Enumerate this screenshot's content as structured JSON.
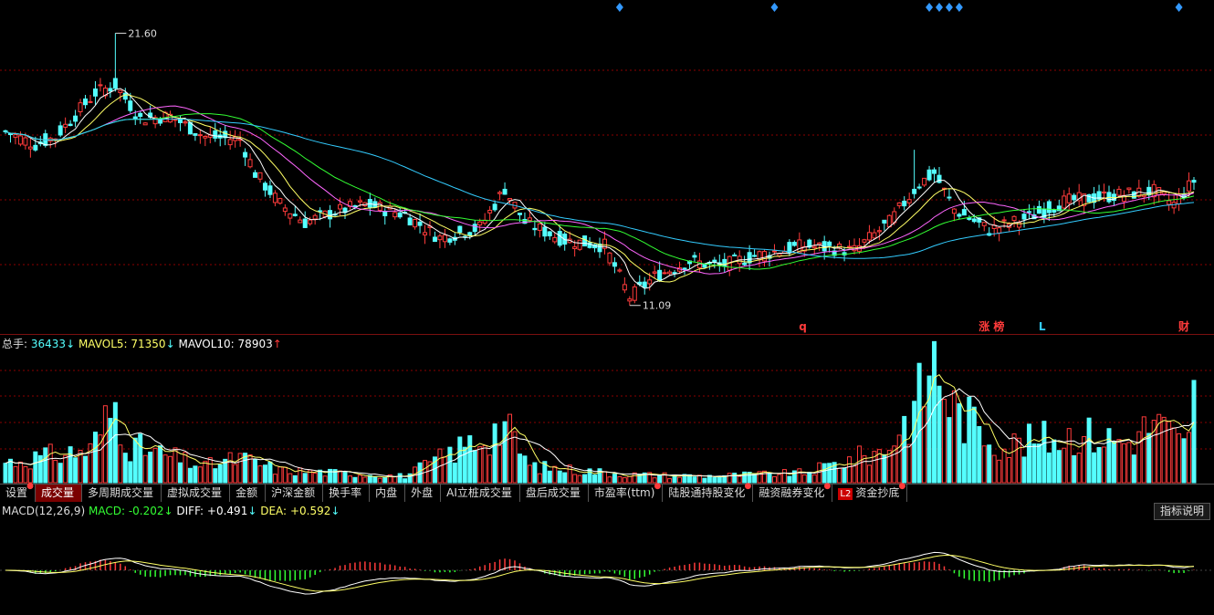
{
  "colors": {
    "up": "#ff3b3b",
    "down": "#54ffff",
    "ma5": "#ffffff",
    "ma10": "#ffff66",
    "ma20": "#ff66ff",
    "ma30": "#33ff33",
    "ma60": "#33ccff",
    "grid": "#8b0000",
    "diamond": "#3399ff"
  },
  "price_pane": {
    "high_label": "21.60",
    "low_label": "11.09",
    "event_markers": [
      {
        "text": "q",
        "color": "#ff3b3b"
      },
      {
        "text": "涨 榜",
        "color": "#ff3b3b"
      },
      {
        "text": "L",
        "color": "#33ccff"
      },
      {
        "text": "财",
        "color": "#ff3b3b"
      }
    ]
  },
  "volume_header": {
    "total_label": "总手:",
    "total_value": "36433",
    "total_arrow": "↓",
    "mavol5_label": "MAVOL5:",
    "mavol5_value": "71350",
    "mavol5_arrow": "↓",
    "mavol10_label": "MAVOL10:",
    "mavol10_value": "78903",
    "mavol10_arrow": "↑"
  },
  "tabs": [
    {
      "label": "设置",
      "dot": true,
      "active": false
    },
    {
      "label": "成交量",
      "dot": false,
      "active": true
    },
    {
      "label": "多周期成交量",
      "dot": false,
      "active": false
    },
    {
      "label": "虚拟成交量",
      "dot": false,
      "active": false
    },
    {
      "label": "金额",
      "dot": false,
      "active": false
    },
    {
      "label": "沪深金额",
      "dot": false,
      "active": false
    },
    {
      "label": "换手率",
      "dot": false,
      "active": false
    },
    {
      "label": "内盘",
      "dot": false,
      "active": false
    },
    {
      "label": "外盘",
      "dot": false,
      "active": false
    },
    {
      "label": "AI立桩成交量",
      "dot": false,
      "active": false
    },
    {
      "label": "盘后成交量",
      "dot": false,
      "active": false
    },
    {
      "label": "市盈率(ttm)",
      "dot": true,
      "active": false
    },
    {
      "label": "陆股通持股变化",
      "dot": true,
      "active": false
    },
    {
      "label": "融资融券变化",
      "dot": true,
      "active": false
    },
    {
      "label": "资金抄底",
      "dot": true,
      "active": false,
      "badge": "L2"
    }
  ],
  "macd_header": {
    "name": "MACD(12,26,9)",
    "macd_label": "MACD:",
    "macd_value": "-0.202",
    "macd_arrow": "↓",
    "diff_label": "DIFF:",
    "diff_value": "+0.491",
    "diff_arrow": "↓",
    "dea_label": "DEA:",
    "dea_value": "+0.592",
    "dea_arrow": "↓"
  },
  "indicator_help_label": "指标说明",
  "chart_data": {
    "type": "candlestick",
    "price_range": [
      10.2,
      22.6
    ],
    "high": 21.6,
    "low": 11.09,
    "price_anchors": [
      [
        0,
        17.8
      ],
      [
        6,
        17.3
      ],
      [
        10,
        17.6
      ],
      [
        18,
        19.3
      ],
      [
        22,
        19.6
      ],
      [
        27,
        18.3
      ],
      [
        33,
        18.4
      ],
      [
        40,
        17.6
      ],
      [
        47,
        17.5
      ],
      [
        50,
        16.2
      ],
      [
        55,
        15.0
      ],
      [
        60,
        14.3
      ],
      [
        66,
        14.7
      ],
      [
        72,
        15.0
      ],
      [
        80,
        14.6
      ],
      [
        87,
        13.7
      ],
      [
        95,
        14.1
      ],
      [
        100,
        15.6
      ],
      [
        104,
        14.3
      ],
      [
        112,
        13.6
      ],
      [
        120,
        13.4
      ],
      [
        125,
        11.4
      ],
      [
        130,
        12.2
      ],
      [
        137,
        12.8
      ],
      [
        143,
        12.6
      ],
      [
        150,
        13.0
      ],
      [
        160,
        13.4
      ],
      [
        170,
        13.2
      ],
      [
        177,
        14.3
      ],
      [
        183,
        15.8
      ],
      [
        186,
        16.2
      ],
      [
        190,
        14.8
      ],
      [
        197,
        14.0
      ],
      [
        205,
        14.5
      ],
      [
        212,
        15.1
      ],
      [
        220,
        15.3
      ],
      [
        230,
        15.5
      ],
      [
        234,
        15.0
      ],
      [
        238,
        15.9
      ]
    ],
    "n_candles": 239,
    "spikes": [
      [
        22,
        21.6
      ],
      [
        125,
        11.09
      ],
      [
        182,
        17.1
      ]
    ],
    "volume_range": [
      0,
      160000
    ],
    "volume_anchors": [
      [
        0,
        25000
      ],
      [
        17,
        40000
      ],
      [
        22,
        95000
      ],
      [
        25,
        45000
      ],
      [
        40,
        20000
      ],
      [
        47,
        30000
      ],
      [
        55,
        15000
      ],
      [
        80,
        8000
      ],
      [
        100,
        70000
      ],
      [
        105,
        20000
      ],
      [
        125,
        10000
      ],
      [
        140,
        8000
      ],
      [
        160,
        12000
      ],
      [
        176,
        40000
      ],
      [
        182,
        90000
      ],
      [
        186,
        150000
      ],
      [
        190,
        90000
      ],
      [
        200,
        45000
      ],
      [
        215,
        60000
      ],
      [
        225,
        50000
      ],
      [
        230,
        75000
      ],
      [
        236,
        45000
      ],
      [
        238,
        110000
      ]
    ],
    "macd_range": [
      -1.6,
      2.0
    ],
    "macd_current": {
      "macd": -0.202,
      "diff": 0.491,
      "dea": 0.592
    }
  }
}
